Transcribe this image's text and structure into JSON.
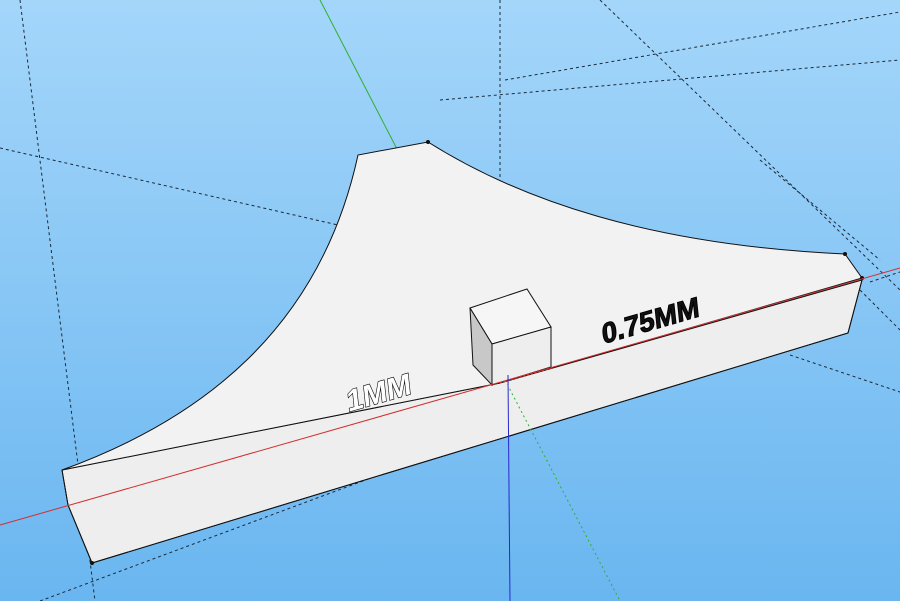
{
  "viewport": {
    "sky_top_color": "#a4d6fa",
    "sky_bottom_color": "#6ab6f0",
    "face_color": "#f0f0f0",
    "edge_color": "#111111"
  },
  "axes": {
    "red_axis_color": "#d03030",
    "green_axis_color": "#30b030",
    "blue_axis_color": "#2828d0"
  },
  "labels": {
    "left_thickness": "1MM",
    "right_thickness": "0.75MM"
  }
}
